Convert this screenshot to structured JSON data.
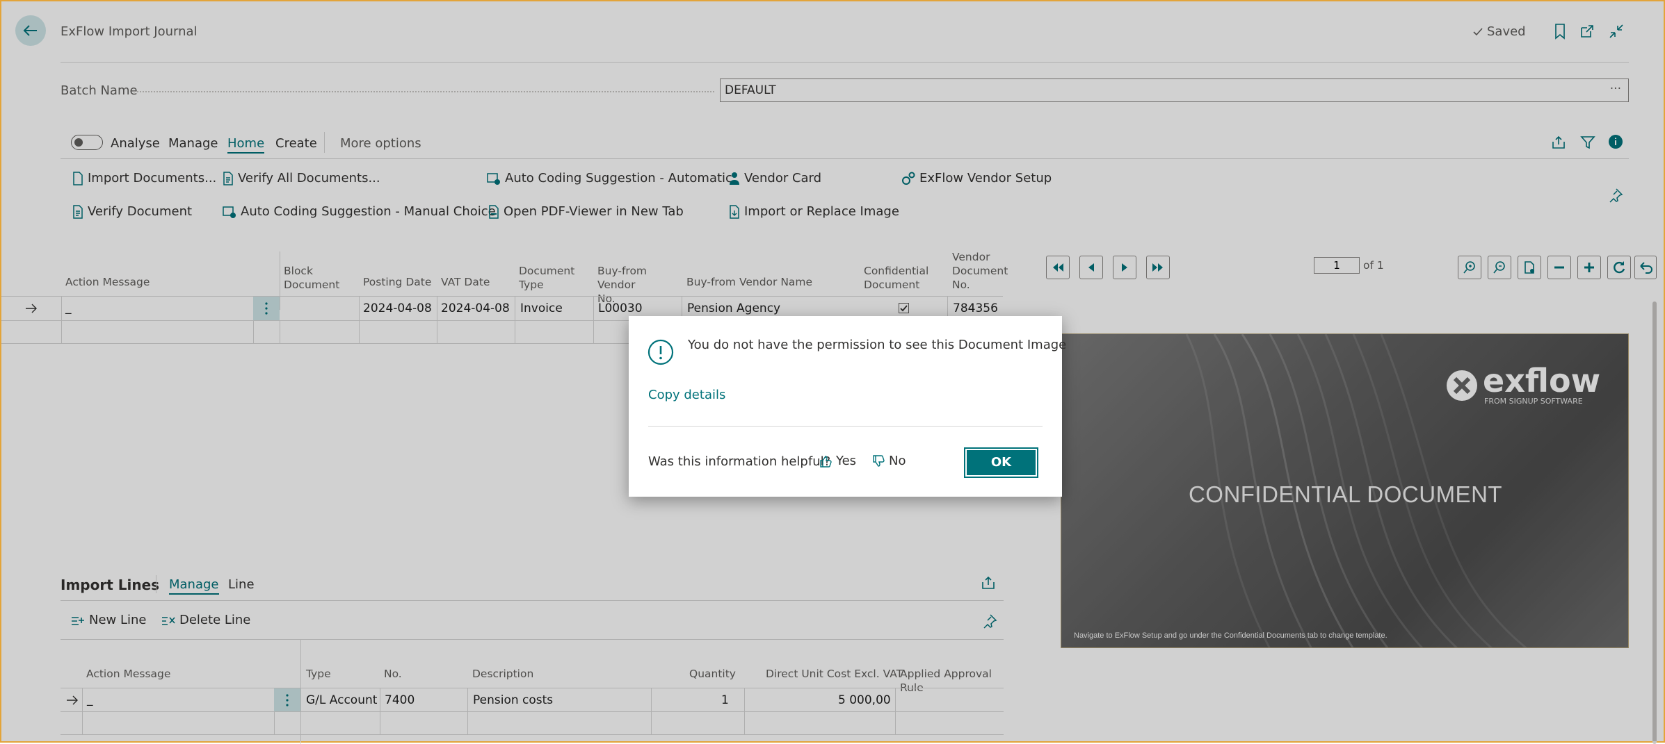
{
  "header": {
    "title": "ExFlow Import Journal",
    "saved": "Saved"
  },
  "batch": {
    "label": "Batch Name",
    "value": "DEFAULT",
    "more": "···"
  },
  "tabs": {
    "analyse": "Analyse",
    "manage": "Manage",
    "home": "Home",
    "create": "Create",
    "more": "More options"
  },
  "actions": {
    "import_documents": "Import Documents...",
    "verify_all": "Verify All Documents...",
    "auto_coding_automatic": "Auto Coding Suggestion - Automatic",
    "vendor_card": "Vendor Card",
    "vendor_setup": "ExFlow Vendor Setup",
    "verify_document": "Verify Document",
    "auto_coding_manual": "Auto Coding Suggestion - Manual Choice",
    "open_pdf": "Open PDF-Viewer in New Tab",
    "import_image": "Import or Replace Image"
  },
  "grid": {
    "headers": {
      "action_message": "Action Message",
      "block_document": "Block Document",
      "posting_date": "Posting Date",
      "vat_date": "VAT Date",
      "document_type": "Document Type",
      "buy_from_vendor_no": "Buy-from Vendor No.",
      "buy_from_vendor_name": "Buy-from Vendor Name",
      "confidential_document": "Confidential Document",
      "vendor_document_no": "Vendor Document No."
    },
    "row": {
      "action_message": "_",
      "posting_date": "2024-04-08",
      "vat_date": "2024-04-08",
      "document_type": "Invoice",
      "vendor_no": "L00030",
      "vendor_name": "Pension Agency",
      "confidential": true,
      "vendor_document_no": "784356"
    }
  },
  "viewer": {
    "page_value": "1",
    "of_label": "of 1",
    "logo_text": "exflow",
    "logo_sub": "FROM SIGNUP SOFTWARE",
    "watermark": "CONFIDENTIAL DOCUMENT",
    "footer_note": "Navigate to ExFlow Setup and go under the Confidential Documents tab to change template."
  },
  "lines": {
    "title": "Import Lines",
    "tab_manage": "Manage",
    "tab_line": "Line",
    "new_line": "New Line",
    "delete_line": "Delete Line",
    "headers": {
      "action_message": "Action Message",
      "type": "Type",
      "no": "No.",
      "description": "Description",
      "quantity": "Quantity",
      "direct_unit_cost": "Direct Unit Cost Excl. VAT",
      "applied_rule": "Applied Approval Rule"
    },
    "row": {
      "action_message": "_",
      "type": "G/L Account",
      "no": "7400",
      "description": "Pension costs",
      "quantity": "1",
      "direct_unit_cost": "5 000,00"
    }
  },
  "dialog": {
    "message": "You do not have the permission to see this Document Image",
    "copy_details": "Copy details",
    "helpful_question": "Was this information helpful?",
    "yes": "Yes",
    "no": "No",
    "ok": "OK"
  },
  "colors": {
    "accent": "#00727a",
    "frame": "#e3a43a"
  }
}
